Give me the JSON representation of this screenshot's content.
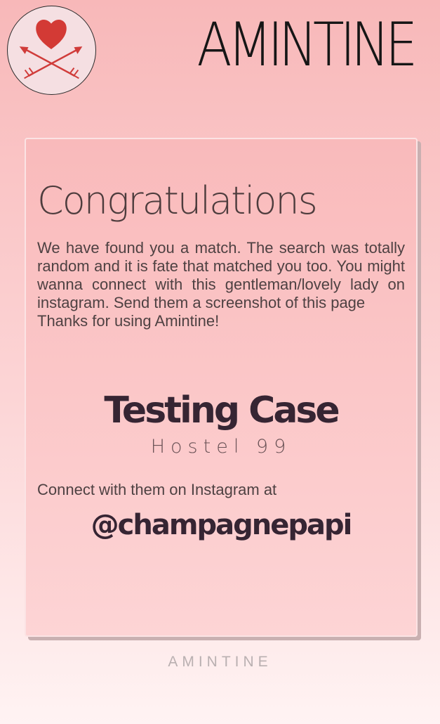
{
  "header": {
    "logo_icon": "heart-arrows-icon",
    "brand_title": "AMINTINE"
  },
  "card": {
    "heading": "Congratulations",
    "message_lines": [
      "We have found you a match. The search was totally random and it is fate that matched you too. You might wanna connect with this gentleman/lovely lady on instagram. Send them a screenshot of this page",
      "Thanks for using Amintine!"
    ],
    "match_name": "Testing Case",
    "match_location": "Hostel 99",
    "connect_label": "Connect with them on Instagram at",
    "instagram_handle": "@champagnepapi"
  },
  "footer": {
    "brand": "AMINTINE"
  },
  "colors": {
    "heart": "#d33a35",
    "arrow": "#d03c3a",
    "background_top": "#f8b8b9",
    "background_bottom": "#fff3f3",
    "heading_text": "#4d3c3d",
    "name_text": "#362533"
  }
}
